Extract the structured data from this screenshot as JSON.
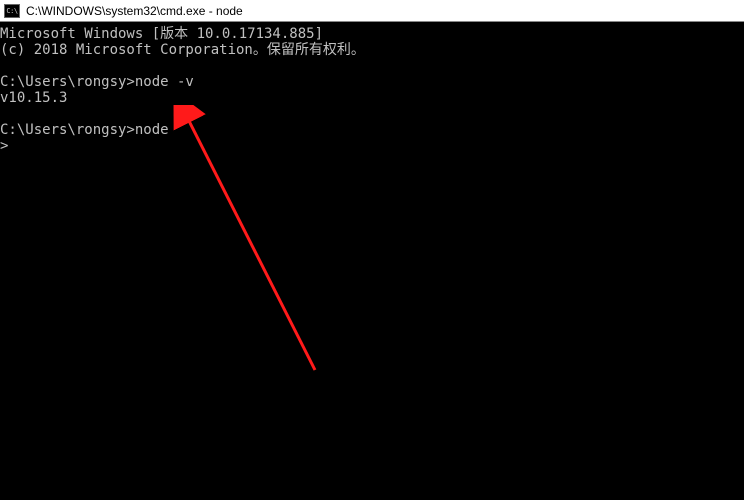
{
  "titlebar": {
    "icon_label": "C:\\",
    "title": "C:\\WINDOWS\\system32\\cmd.exe - node"
  },
  "terminal": {
    "line1": "Microsoft Windows [版本 10.0.17134.885]",
    "line2": "(c) 2018 Microsoft Corporation。保留所有权利。",
    "blank1": "",
    "prompt1": "C:\\Users\\rongsy>node -v",
    "output1": "v10.15.3",
    "blank2": "",
    "prompt2": "C:\\Users\\rongsy>node",
    "repl": "> "
  }
}
